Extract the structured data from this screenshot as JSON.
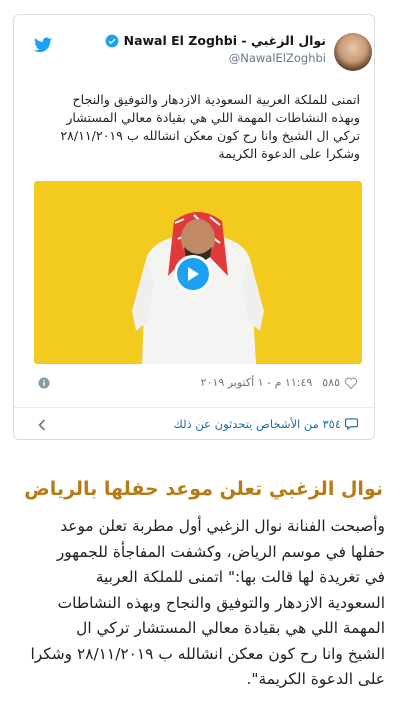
{
  "tweet": {
    "author_name": "Nawal El Zoghbi - نوال الزغبي",
    "author_handle": "@NawalElZoghbi",
    "text_lines": [
      "اتمنى للملكة العربية السعودية الازدهار والتوفيق والنجاح",
      "وبهذه النشاطات المهمة اللي هي بقيادة  معالي المستشار",
      "تركي ال الشيخ وانا رح كون معكن انشالله ب ٢٨/١١/٢٠١٩",
      "وشكرا على الدعوة الكريمة"
    ],
    "likes": "٥٨٥",
    "timestamp": "١١:٤٩ م - ١ أكتوبر ٢٠١٩",
    "replies_text": "٣٥٤ من الأشخاص يتحدثون عن ذلك"
  },
  "article": {
    "title": "نوال الزغبي تعلن موعد حفلها بالرياض",
    "body_lines": [
      "وأصبحت الفنانة نوال الزغبي أول مطربة تعلن موعد",
      "حفلها في موسم الرياض، وكشفت المفاجأة للجمهور",
      "في تغريدة لها قالت بها:\" اتمنى للملكة العربية",
      "السعودية الازدهار والتوفيق والنجاح وبهذه النشاطات",
      "المهمة اللي هي بقيادة  معالي المستشار تركي ال",
      "الشيخ وانا رح كون معكن انشالله ب ٢٨/١١/٢٠١٩  وشكرا",
      "على الدعوة الكريمة\"."
    ]
  },
  "colors": {
    "twitter_blue": "#1da1f2",
    "video_bg": "#f3ca1e",
    "title_gold": "#b87a12"
  },
  "icons": [
    "twitter-icon",
    "verified-icon",
    "play-icon",
    "info-icon",
    "heart-icon",
    "chevron-left-icon",
    "comment-icon"
  ]
}
